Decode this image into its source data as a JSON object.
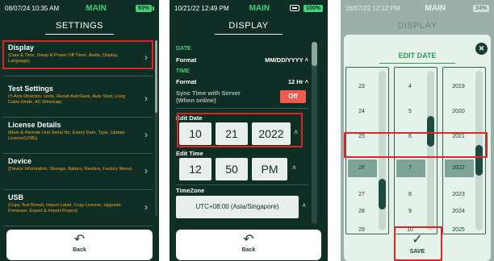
{
  "panel1": {
    "status": {
      "time": "08/07/24 10:35 AM",
      "mode": "MAIN",
      "battery": "93%"
    },
    "title": "SETTINGS",
    "items": [
      {
        "title": "Display",
        "subtitle": "(Date & Time, Sleep & Power Off Timer, Audio, Display, Language)"
      },
      {
        "title": "Test Settings",
        "subtitle": "(Y-Axis Direction, Units, Result AutoSave, Auto Start, Long Cable Mode, AC Wiremap)"
      },
      {
        "title": "License Details",
        "subtitle": "(Main & Remote Unit Serial No, Expiry Date, Type, Update License(USB))"
      },
      {
        "title": "Device",
        "subtitle": "(Device Information, Storage, Battery, Restore, Factory Menu)"
      },
      {
        "title": "USB",
        "subtitle": "(Copy Test Result, Import Label, Copy License, Upgrade Firmware, Export & Import Project)"
      }
    ],
    "back_label": "Back"
  },
  "panel2": {
    "status": {
      "time": "10/21/22 12:49 PM",
      "mode": "MAIN",
      "battery": "100%"
    },
    "title": "DISPLAY",
    "date_section": "DATE",
    "date_format_label": "Format",
    "date_format_value": "MM/DD/YYYY",
    "time_section": "TIME",
    "time_format_label": "Format",
    "time_format_value": "12 Hr",
    "sync_label_1": "Sync Time with Server",
    "sync_label_2": "(When online)",
    "sync_value": "Off",
    "edit_date_label": "Edit Date",
    "edit_date": {
      "month": "10",
      "day": "21",
      "year": "2022"
    },
    "edit_time_label": "Edit Time",
    "edit_time": {
      "hour": "12",
      "minute": "50",
      "ampm": "PM"
    },
    "timezone_label": "TimeZone",
    "timezone_value": "UTC+08:00 (Asia/Singapore)",
    "back_label": "Back"
  },
  "panel3": {
    "status": {
      "time": "26/07/22 12:12 PM",
      "mode": "MAIN",
      "battery": "34%"
    },
    "title": "DISPLAY",
    "modal_title": "EDIT DATE",
    "day_values": [
      "23",
      "24",
      "25",
      "26",
      "27",
      "28",
      "29"
    ],
    "month_values": [
      "4",
      "5",
      "6",
      "7",
      "8",
      "9",
      "10"
    ],
    "year_values": [
      "2019",
      "2020",
      "2021",
      "2022",
      "2023",
      "2024",
      "2025"
    ],
    "save_label": "SAVE"
  },
  "colors": {
    "background": "#0f2e26",
    "accent": "#3fd37a",
    "subtitle": "#f5a623",
    "highlight": "#e02424",
    "toggle_off": "#f05a4f"
  }
}
